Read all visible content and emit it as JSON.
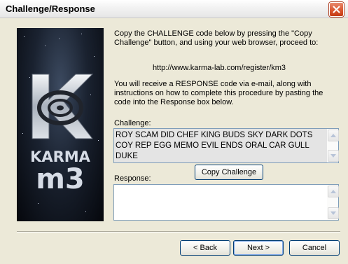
{
  "window": {
    "title": "Challenge/Response"
  },
  "logo": {
    "brand": "KARMA",
    "product": "m3"
  },
  "instructions": {
    "line1": "Copy the CHALLENGE code below by pressing the \"Copy Challenge\" button, and using your web browser, proceed to:",
    "url": "http://www.karma-lab.com/register/km3",
    "line2": "You will receive a RESPONSE code via e-mail, along with instructions on how to complete this procedure by pasting the code into the Response box below."
  },
  "challenge": {
    "label": "Challenge:",
    "value": "ROY SCAM DID CHEF KING BUDS SKY DARK DOTS COY REP EGG MEMO EVIL ENDS ORAL CAR GULL DUKE"
  },
  "buttons": {
    "copy": "Copy Challenge",
    "back": "< Back",
    "next": "Next >",
    "cancel": "Cancel"
  },
  "response": {
    "label": "Response:",
    "value": ""
  }
}
